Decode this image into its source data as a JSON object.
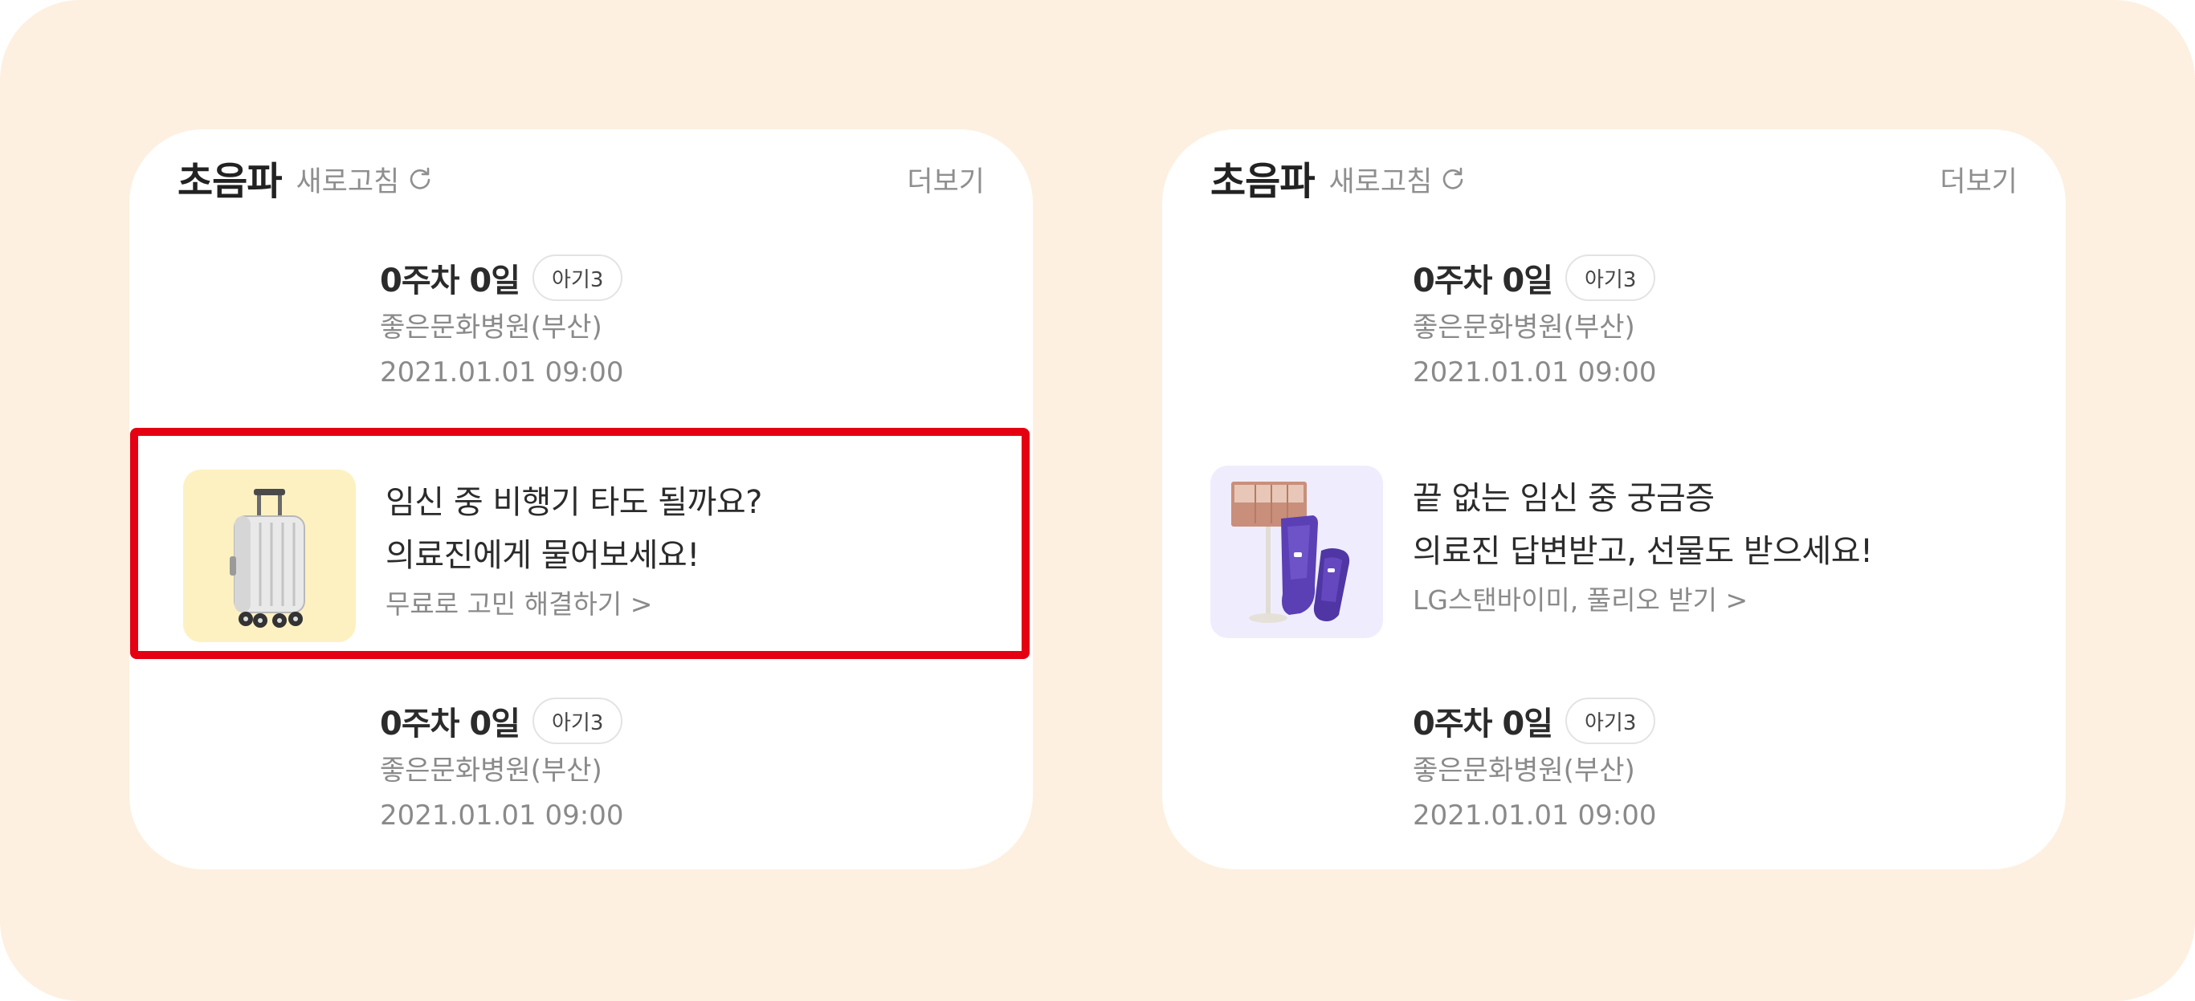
{
  "colors": {
    "background": "#fdf0e0",
    "card": "#ffffff",
    "highlight_border": "#e50012",
    "primary_text": "#2b2b2b",
    "secondary_text": "#8a8a8a",
    "thumb_left_bg": "#fdf1c2",
    "thumb_right_bg": "#efedfd"
  },
  "cards": [
    {
      "header": {
        "title": "초음파",
        "refresh_label": "새로고침",
        "refresh_icon": "refresh-icon",
        "more_label": "더보기"
      },
      "records": [
        {
          "week": "0주차 0일",
          "baby": "아기3",
          "hospital": "좋은문화병원(부산)",
          "datetime": "2021.01.01 09:00"
        },
        {
          "week": "0주차 0일",
          "baby": "아기3",
          "hospital": "좋은문화병원(부산)",
          "datetime": "2021.01.01 09:00"
        }
      ],
      "promo": {
        "line1": "임신 중 비행기 타도 될까요?",
        "line2": "의료진에게 물어보세요!",
        "link": "무료로 고민 해결하기 >",
        "thumbnail": "suitcase-image"
      }
    },
    {
      "header": {
        "title": "초음파",
        "refresh_label": "새로고침",
        "refresh_icon": "refresh-icon",
        "more_label": "더보기"
      },
      "records": [
        {
          "week": "0주차 0일",
          "baby": "아기3",
          "hospital": "좋은문화병원(부산)",
          "datetime": "2021.01.01 09:00"
        },
        {
          "week": "0주차 0일",
          "baby": "아기3",
          "hospital": "좋은문화병원(부산)",
          "datetime": "2021.01.01 09:00"
        }
      ],
      "promo": {
        "line1": "끝 없는 임신 중 궁금증",
        "line2": "의료진 답변받고, 선물도 받으세요!",
        "link": "LG스탠바이미, 풀리오 받기 >",
        "thumbnail": "stanbyme-massager-image"
      }
    }
  ]
}
